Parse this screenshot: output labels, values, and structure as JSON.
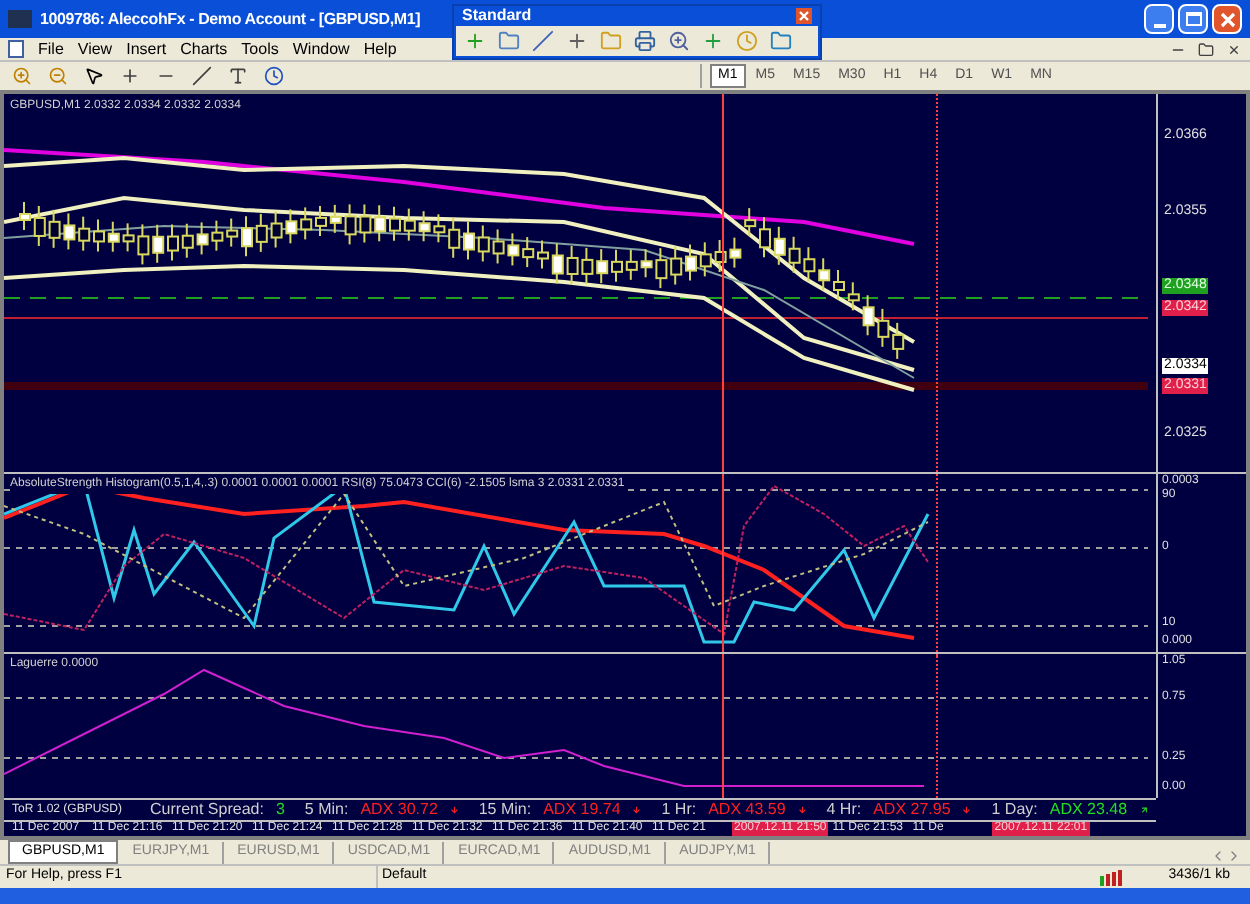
{
  "window": {
    "title": "1009786: AleccohFx - Demo Account - [GBPUSD,M1]"
  },
  "floating_toolbar": {
    "title": "Standard"
  },
  "menu": [
    "File",
    "View",
    "Insert",
    "Charts",
    "Tools",
    "Window",
    "Help"
  ],
  "timeframes": [
    {
      "label": "M1",
      "selected": true
    },
    {
      "label": "M5",
      "selected": false
    },
    {
      "label": "M15",
      "selected": false
    },
    {
      "label": "M30",
      "selected": false
    },
    {
      "label": "H1",
      "selected": false
    },
    {
      "label": "H4",
      "selected": false
    },
    {
      "label": "D1",
      "selected": false
    },
    {
      "label": "W1",
      "selected": false
    },
    {
      "label": "MN",
      "selected": false
    }
  ],
  "main_pane": {
    "caption": "GBPUSD,M1  2.0332 2.0334 2.0332 2.0334",
    "price_labels": [
      {
        "text": "2.0366",
        "kind": "tick"
      },
      {
        "text": "2.0355",
        "kind": "tick"
      },
      {
        "text": "2.0348",
        "kind": "line"
      },
      {
        "text": "2.0342",
        "kind": "alert"
      },
      {
        "text": "2.0334",
        "kind": "bid"
      },
      {
        "text": "2.0331",
        "kind": "alert"
      },
      {
        "text": "2.0325",
        "kind": "tick"
      }
    ]
  },
  "indicator_pane": {
    "caption": "AbsoluteStrength Histogram(0.5,1,4,.3) 0.0001 0.0001 0.0001 RSI(8) 75.0473  CCI(6) -2.1505  lsma 3 2.0331 2.0331",
    "scale": [
      "0.0003",
      "90",
      "0",
      "10",
      "0.000"
    ]
  },
  "laguerre_pane": {
    "caption": "Laguerre 0.0000",
    "scale": [
      "1.05",
      "0.75",
      "0.25",
      "0.00"
    ]
  },
  "info_bar": {
    "symbol": "ToR 1.02 (GBPUSD)",
    "spread_label": "Current Spread:",
    "spread": "3",
    "frames": [
      {
        "label": "5 Min:",
        "adx": "ADX 30.72",
        "rising": false
      },
      {
        "label": "15 Min:",
        "adx": "ADX 19.74",
        "rising": false
      },
      {
        "label": "1 Hr:",
        "adx": "ADX 43.59",
        "rising": false
      },
      {
        "label": "4 Hr:",
        "adx": "ADX 27.95",
        "rising": false
      },
      {
        "label": "1 Day:",
        "adx": "ADX 23.48",
        "rising": true
      }
    ]
  },
  "time_axis": [
    {
      "text": "11 Dec 2007",
      "kind": "tick"
    },
    {
      "text": "11 Dec 21:16",
      "kind": "tick"
    },
    {
      "text": "11 Dec 21:20",
      "kind": "tick"
    },
    {
      "text": "11 Dec 21:24",
      "kind": "tick"
    },
    {
      "text": "11 Dec 21:28",
      "kind": "tick"
    },
    {
      "text": "11 Dec 21:32",
      "kind": "tick"
    },
    {
      "text": "11 Dec 21:36",
      "kind": "tick"
    },
    {
      "text": "11 Dec 21:40",
      "kind": "tick"
    },
    {
      "text": "11 Dec 21",
      "kind": "tick"
    },
    {
      "text": "2007.12.11 21:50",
      "kind": "marker"
    },
    {
      "text": "11 Dec 21:53",
      "kind": "tick"
    },
    {
      "text": "11 De",
      "kind": "tick"
    },
    {
      "text": "2007.12.11 22:01",
      "kind": "marker"
    }
  ],
  "chart_tabs": [
    {
      "label": "GBPUSD,M1",
      "selected": true
    },
    {
      "label": "EURJPY,M1",
      "selected": false
    },
    {
      "label": "EURUSD,M1",
      "selected": false
    },
    {
      "label": "USDCAD,M1",
      "selected": false
    },
    {
      "label": "EURCAD,M1",
      "selected": false
    },
    {
      "label": "AUDUSD,M1",
      "selected": false
    },
    {
      "label": "AUDJPY,M1",
      "selected": false
    }
  ],
  "status_bar": {
    "help": "For Help, press F1",
    "profile": "Default",
    "traffic": "3436/1 kb"
  }
}
